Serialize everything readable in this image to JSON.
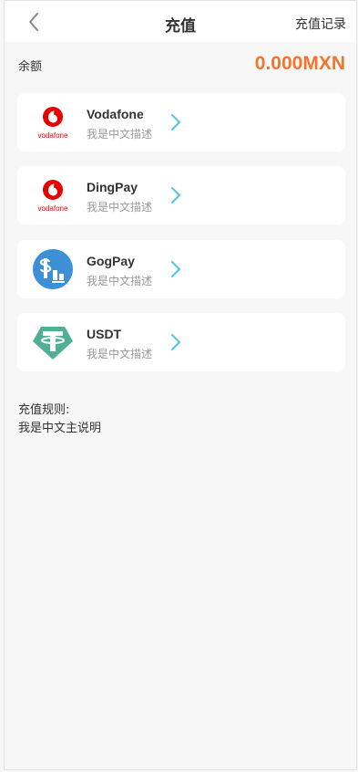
{
  "header": {
    "title": "充值",
    "record_label": "充值记录"
  },
  "balance": {
    "label": "余额",
    "value": "0.000MXN"
  },
  "payments": [
    {
      "name": "Vodafone",
      "desc": "我是中文描述",
      "logo_text": "vodafone",
      "icon": "vodafone-logo"
    },
    {
      "name": "DingPay",
      "desc": "我是中文描述",
      "logo_text": "vodafone",
      "icon": "vodafone-logo"
    },
    {
      "name": "GogPay",
      "desc": "我是中文描述",
      "icon": "gogpay-logo"
    },
    {
      "name": "USDT",
      "desc": "我是中文描述",
      "icon": "tether-logo"
    }
  ],
  "rules": {
    "title": "充值规则:",
    "text": "我是中文主说明"
  },
  "colors": {
    "accent": "#f5742d",
    "chevron": "#5bc8dc",
    "vodafone_red": "#e60000",
    "gogpay_blue": "#3d8fd6",
    "tether_green": "#50af95"
  }
}
